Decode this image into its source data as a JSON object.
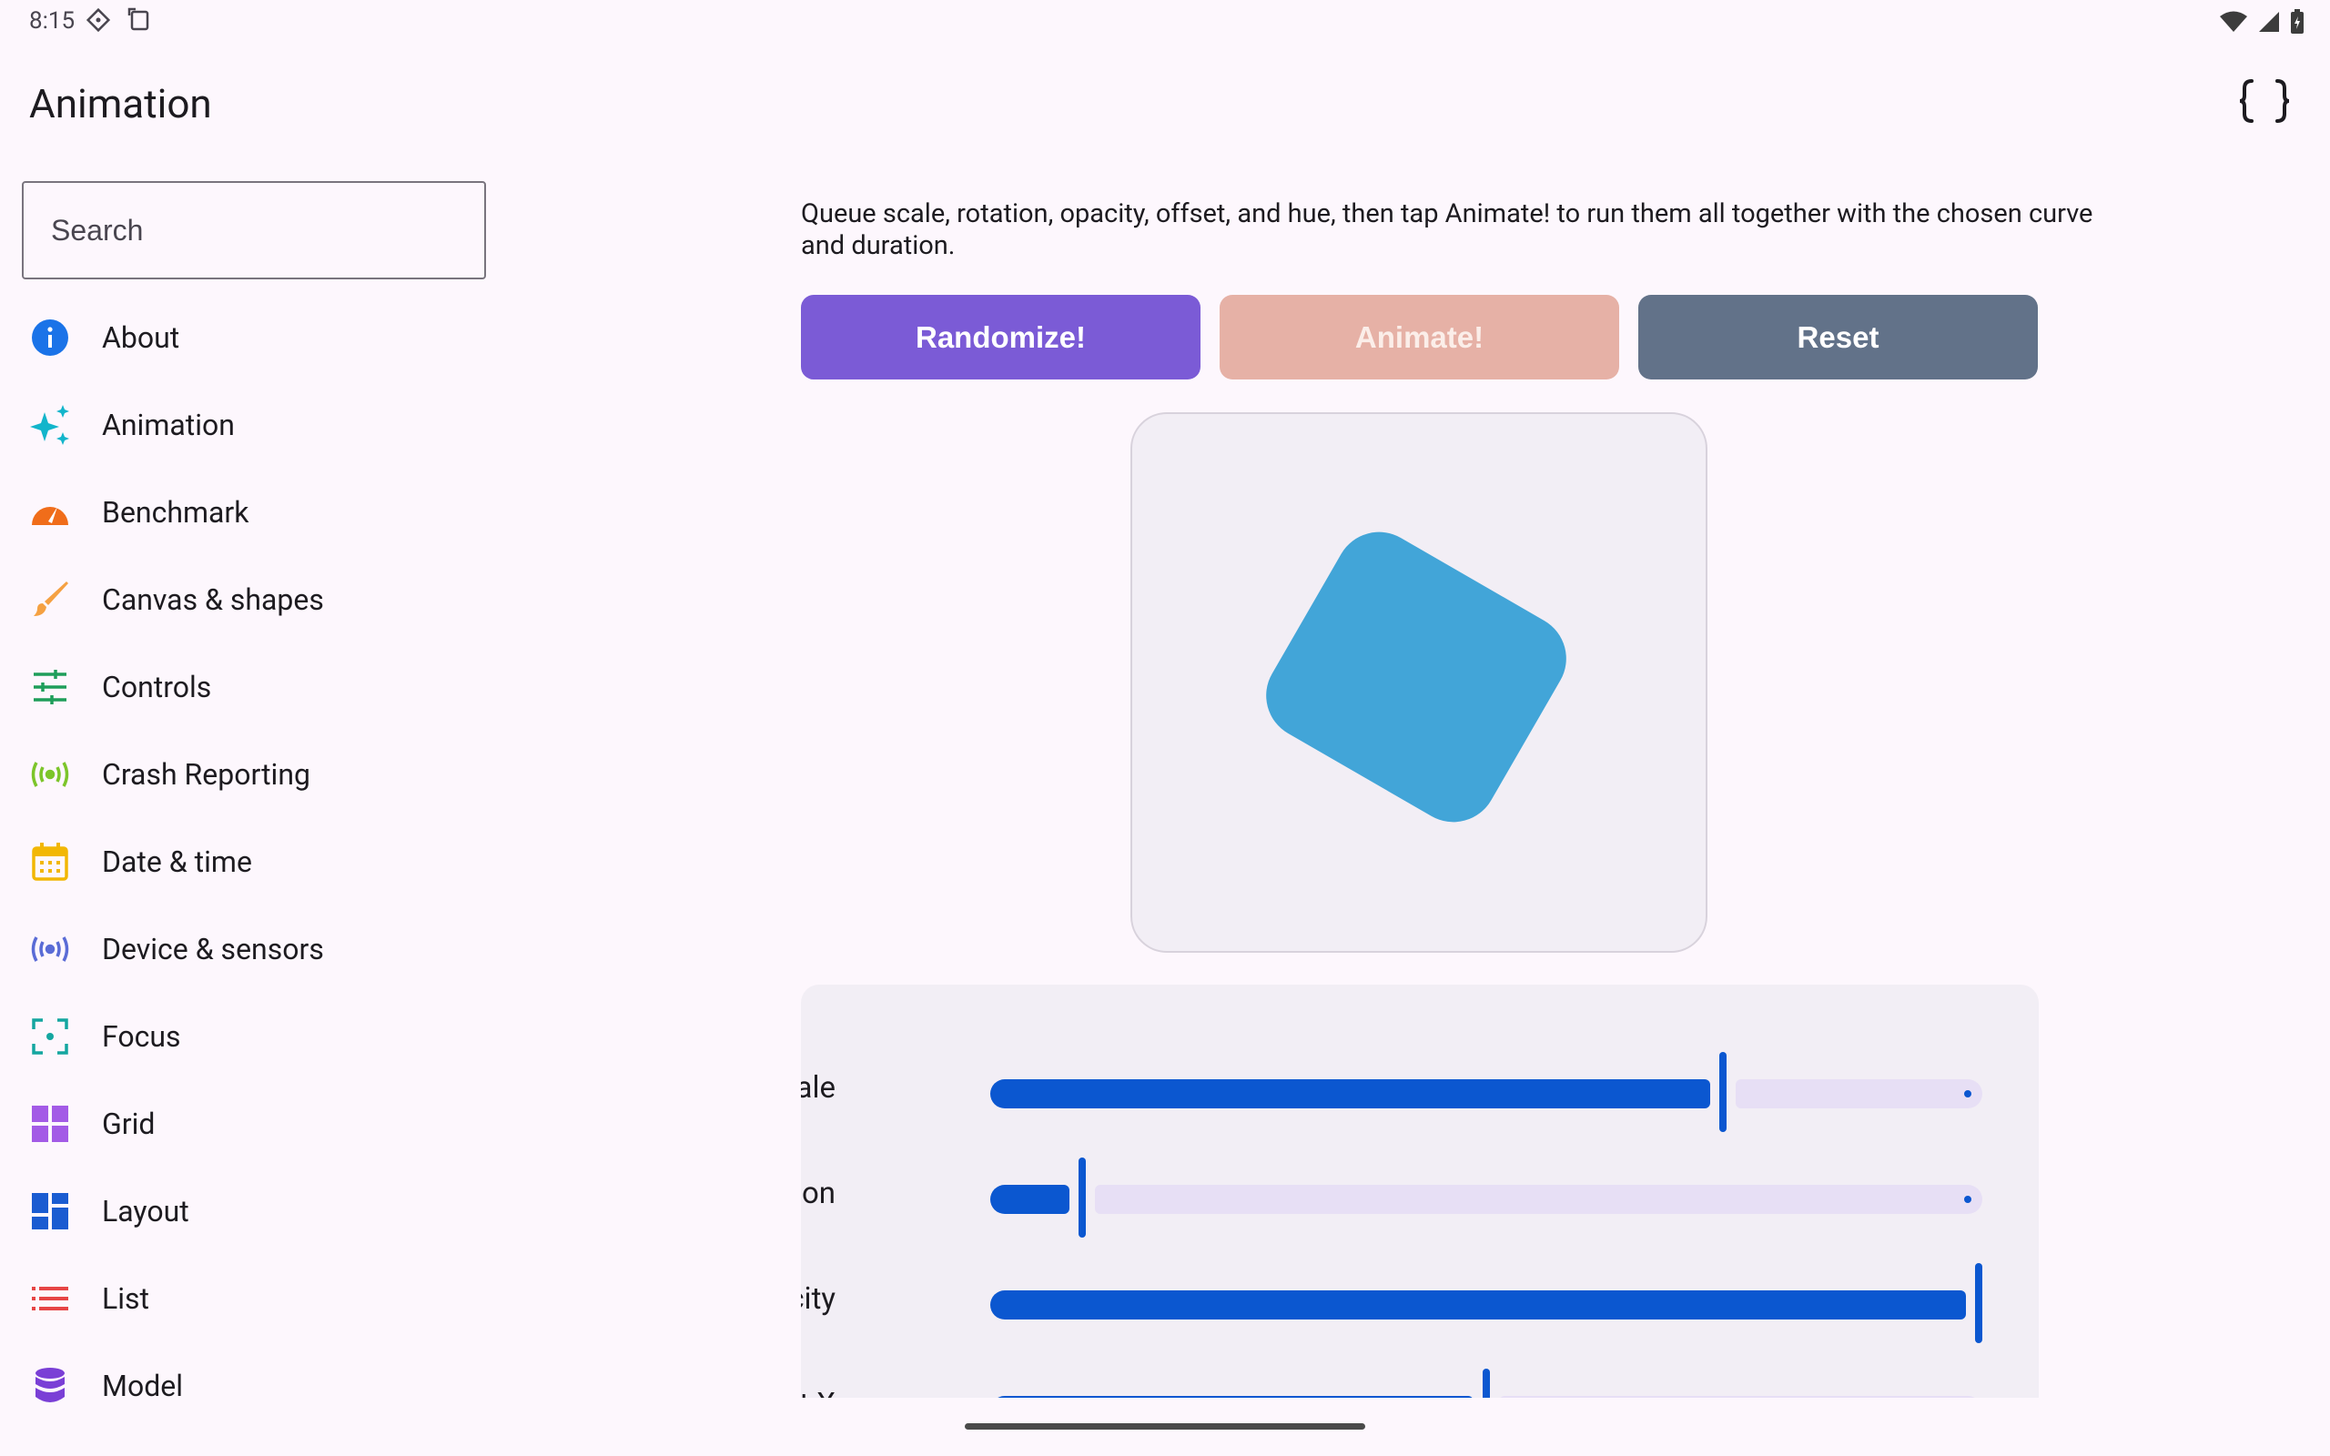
{
  "status_bar": {
    "time": "8:15",
    "icons": [
      "assistant-diamond-icon",
      "screenshot-icon",
      "wifi-icon",
      "signal-icon",
      "battery-icon"
    ]
  },
  "app_bar": {
    "title": "Animation",
    "action_icon": "code-braces-icon"
  },
  "search": {
    "placeholder": "Search",
    "value": ""
  },
  "nav": {
    "items": [
      {
        "label": "About",
        "icon": "info-icon",
        "color": "#1a73e8"
      },
      {
        "label": "Animation",
        "icon": "sparkle-icon",
        "color": "#12b5cb"
      },
      {
        "label": "Benchmark",
        "icon": "speedometer-icon",
        "color": "#f06d1a"
      },
      {
        "label": "Canvas & shapes",
        "icon": "brush-icon",
        "color": "#f5a142"
      },
      {
        "label": "Controls",
        "icon": "tune-icon",
        "color": "#1e9e5a"
      },
      {
        "label": "Crash Reporting",
        "icon": "broadcast-icon",
        "color": "#7cc52a"
      },
      {
        "label": "Date & time",
        "icon": "calendar-icon",
        "color": "#f2b705"
      },
      {
        "label": "Device & sensors",
        "icon": "sensors-icon",
        "color": "#5a6cd6"
      },
      {
        "label": "Focus",
        "icon": "focus-icon",
        "color": "#14a6a0"
      },
      {
        "label": "Grid",
        "icon": "grid-icon",
        "color": "#a35be6"
      },
      {
        "label": "Layout",
        "icon": "layout-icon",
        "color": "#1a5cd1"
      },
      {
        "label": "List",
        "icon": "list-icon",
        "color": "#e64545"
      },
      {
        "label": "Model",
        "icon": "database-icon",
        "color": "#7a3fd6"
      }
    ]
  },
  "main": {
    "description": "Queue scale, rotation, opacity, offset, and hue, then tap Animate! to run them all together with the chosen curve and duration.",
    "buttons": {
      "randomize": "Randomize!",
      "animate": "Animate!",
      "reset": "Reset"
    },
    "shape_color": "#42a5d8",
    "sliders": [
      {
        "label": "Scale",
        "value": 0.74
      },
      {
        "label": "Rotation",
        "value": 0.09
      },
      {
        "label": "Opacity",
        "value": 1.0
      },
      {
        "label": "Offset X",
        "value": 0.5
      }
    ]
  }
}
